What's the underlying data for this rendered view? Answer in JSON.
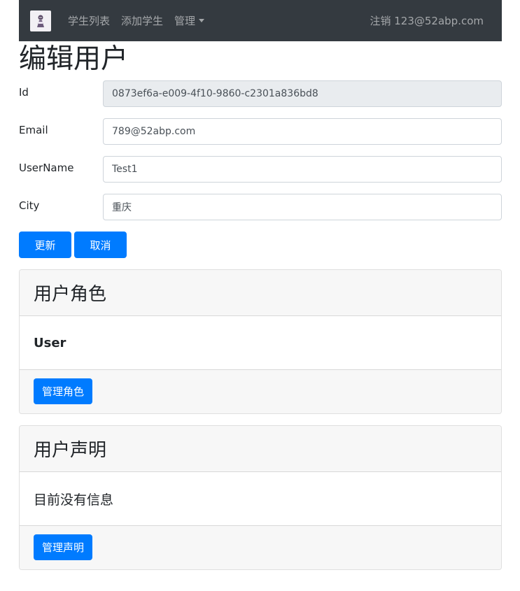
{
  "navbar": {
    "links": [
      "学生列表",
      "添加学生",
      "管理"
    ],
    "logout_label": "注销 123@52abp.com"
  },
  "page": {
    "title": "编辑用户"
  },
  "form": {
    "id_label": "Id",
    "id_value": "0873ef6a-e009-4f10-9860-c2301a836bd8",
    "email_label": "Email",
    "email_value": "789@52abp.com",
    "username_label": "UserName",
    "username_value": "Test1",
    "city_label": "City",
    "city_value": "重庆",
    "update_button": "更新",
    "cancel_button": "取消"
  },
  "roles_card": {
    "title": "用户角色",
    "role": "User",
    "manage_button": "管理角色"
  },
  "claims_card": {
    "title": "用户声明",
    "empty_text": "目前没有信息",
    "manage_button": "管理声明"
  },
  "colors": {
    "navbar_bg": "#343a40",
    "primary": "#007bff",
    "card_header_bg": "#f7f7f7",
    "readonly_bg": "#e9ecef"
  }
}
